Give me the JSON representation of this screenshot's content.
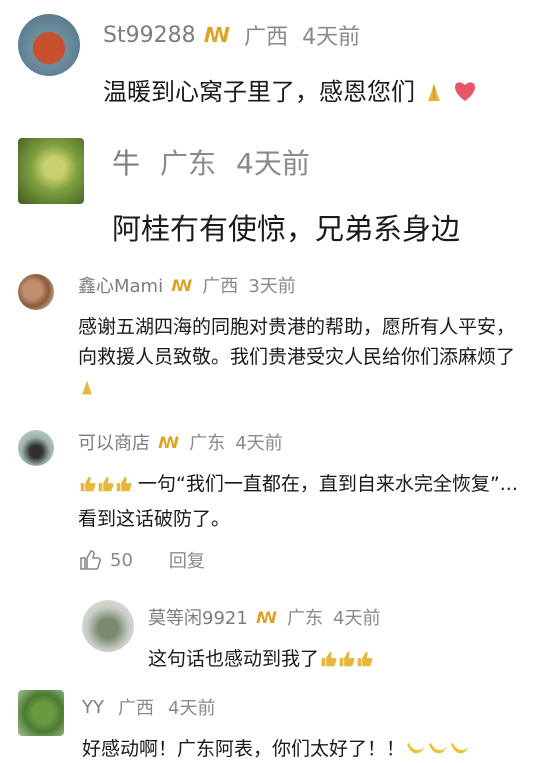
{
  "comments": [
    {
      "name": "St99288",
      "location": "广西",
      "time": "4天前",
      "text": "温暖到心窝子里了，感恩您们"
    },
    {
      "name": "牛",
      "location": "广东",
      "time": "4天前",
      "text": "阿桂冇有使惊，兄弟系身边"
    },
    {
      "name": "鑫心Mami",
      "location": "广西",
      "time": "3天前",
      "text": "感谢五湖四海的同胞对贵港的帮助，愿所有人平安，向救援人员致敬。我们贵港受灾人民给你们添麻烦了"
    },
    {
      "name": "可以商店",
      "location": "广东",
      "time": "4天前",
      "text": "一句“我们一直都在，直到自来水完全恢复”...看到这话破防了。",
      "likes": "50",
      "reply_label": "回复"
    },
    {
      "name": "莫等闲9921",
      "location": "广东",
      "time": "4天前",
      "text": "这句话也感动到我了"
    },
    {
      "name": "YY",
      "location": "广西",
      "time": "4天前",
      "text": "好感动啊！广东阿表，你们太好了！！"
    }
  ],
  "colors": {
    "meta": "#8a8a8a",
    "text": "#1a1a1a",
    "badge": "#e0a020"
  },
  "icons": [
    "vip-badge-icon",
    "pray-hands-emoji",
    "heart-emoji",
    "thumbs-up-emoji",
    "like-icon",
    "banana-emoji"
  ]
}
